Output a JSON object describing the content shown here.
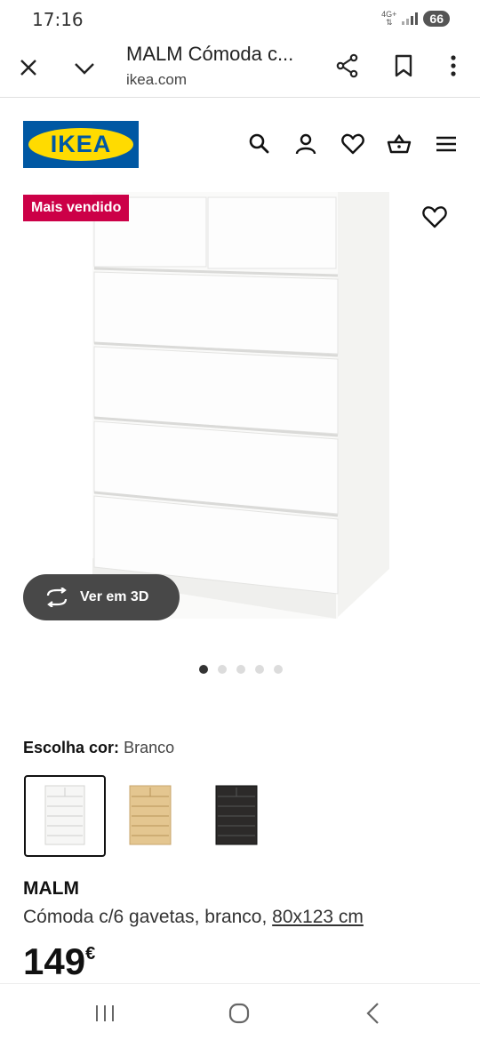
{
  "status_bar": {
    "time": "17:16",
    "network_top": "4G+",
    "battery": "66"
  },
  "browser": {
    "title": "MALM Cómoda c...",
    "url": "ikea.com"
  },
  "site": {
    "logo_text": "IKEA",
    "brand_blue": "#0058a3",
    "brand_yellow": "#ffdb00"
  },
  "gallery": {
    "badge": "Mais vendido",
    "badge_color": "#cc0047",
    "view3d_label": "Ver em 3D",
    "dot_count": 5,
    "active_dot": 1
  },
  "color_chooser": {
    "label": "Escolha cor:",
    "selected": "Branco",
    "options": [
      {
        "name": "white",
        "color": "#f4f4f2"
      },
      {
        "name": "white-stained-oak",
        "color": "#e3c48f"
      },
      {
        "name": "black-brown",
        "color": "#2b2a29"
      }
    ]
  },
  "product": {
    "name": "MALM",
    "description": "Cómoda c/6 gavetas, branco, ",
    "dimensions": "80x123 cm",
    "price": "149",
    "currency": "€"
  },
  "icons": {
    "browser": [
      "close-icon",
      "chevron-down-icon",
      "share-icon",
      "bookmark-icon",
      "more-vert-icon"
    ],
    "header": [
      "search-icon",
      "user-icon",
      "heart-icon",
      "cart-icon",
      "menu-icon"
    ],
    "nav": [
      "recent-apps-icon",
      "home-icon",
      "back-icon"
    ]
  }
}
